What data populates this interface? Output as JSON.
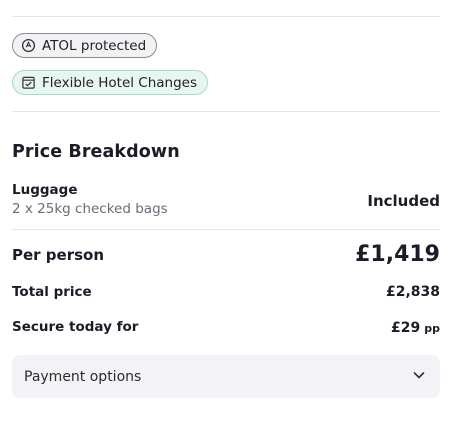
{
  "badges": {
    "atol": {
      "label": "ATOL protected",
      "icon": "atol-shield-icon"
    },
    "hotel": {
      "label": "Flexible Hotel Changes",
      "icon": "calendar-check-icon"
    }
  },
  "price_breakdown": {
    "title": "Price Breakdown",
    "luggage": {
      "label": "Luggage",
      "detail": "2 x 25kg checked bags",
      "value": "Included"
    },
    "per_person": {
      "label": "Per person",
      "value": "£1,419"
    },
    "total": {
      "label": "Total price",
      "value": "£2,838"
    },
    "secure": {
      "label": "Secure today for",
      "value": "£29",
      "unit": "pp"
    }
  },
  "payment_options": {
    "label": "Payment options",
    "icon": "chevron-down-icon"
  },
  "colors": {
    "text": "#1c1c28",
    "muted": "#6b6b78",
    "divider": "#e4e4ea",
    "badge_green_bg": "#e8f6f0",
    "badge_green_border": "#a9d8c8",
    "panel_bg": "#f3f2f7"
  }
}
